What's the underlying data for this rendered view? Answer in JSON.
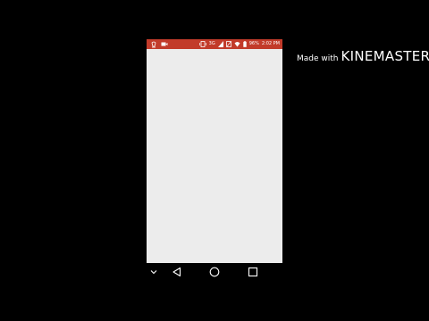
{
  "colors": {
    "background": "#000000",
    "status_bar": "#c23b2a",
    "screen": "#ececec",
    "nav_icons": "#ffffff"
  },
  "status_bar": {
    "left_icons": [
      "notification-icon",
      "video-call-icon"
    ],
    "right_icons": [
      "vibrate-icon",
      "signal-3g-icon",
      "no-sim-icon",
      "wifi-icon",
      "battery-icon"
    ],
    "network_label": "3G",
    "battery_label": "96%",
    "time": "2:02 PM"
  },
  "nav_bar": {
    "buttons": [
      "chevron-down-icon",
      "back-icon",
      "home-icon",
      "recents-icon"
    ]
  },
  "watermark": {
    "prefix": "Made with",
    "brand_part1": "KINE",
    "brand_part2": "MASTER"
  }
}
